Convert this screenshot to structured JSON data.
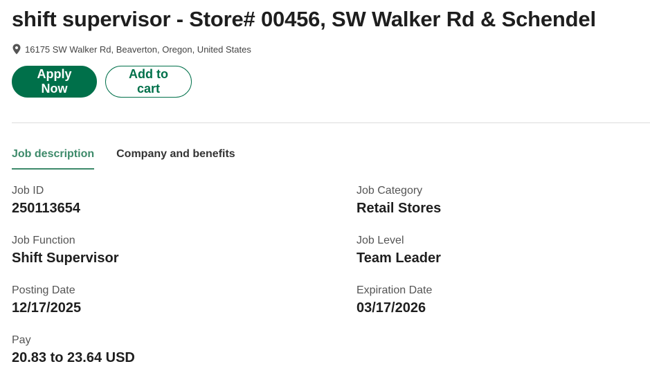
{
  "job": {
    "title": "shift supervisor - Store# 00456, SW Walker Rd & Schendel",
    "location": "16175 SW Walker Rd, Beaverton, Oregon, United States"
  },
  "actions": {
    "apply_label": "Apply Now",
    "cart_label": "Add to cart"
  },
  "tabs": [
    {
      "label": "Job description",
      "active": true
    },
    {
      "label": "Company and benefits",
      "active": false
    }
  ],
  "details": {
    "job_id": {
      "label": "Job ID",
      "value": "250113654"
    },
    "job_category": {
      "label": "Job Category",
      "value": "Retail Stores"
    },
    "job_function": {
      "label": "Job Function",
      "value": "Shift Supervisor"
    },
    "job_level": {
      "label": "Job Level",
      "value": "Team Leader"
    },
    "posting_date": {
      "label": "Posting Date",
      "value": "12/17/2025"
    },
    "expiration_date": {
      "label": "Expiration Date",
      "value": "03/17/2026"
    },
    "pay": {
      "label": "Pay",
      "value": "20.83 to 23.64 USD"
    }
  },
  "icons": {
    "location": "map-pin-icon"
  },
  "colors": {
    "brand": "#00704a",
    "tab_active": "#3d8a6a"
  }
}
